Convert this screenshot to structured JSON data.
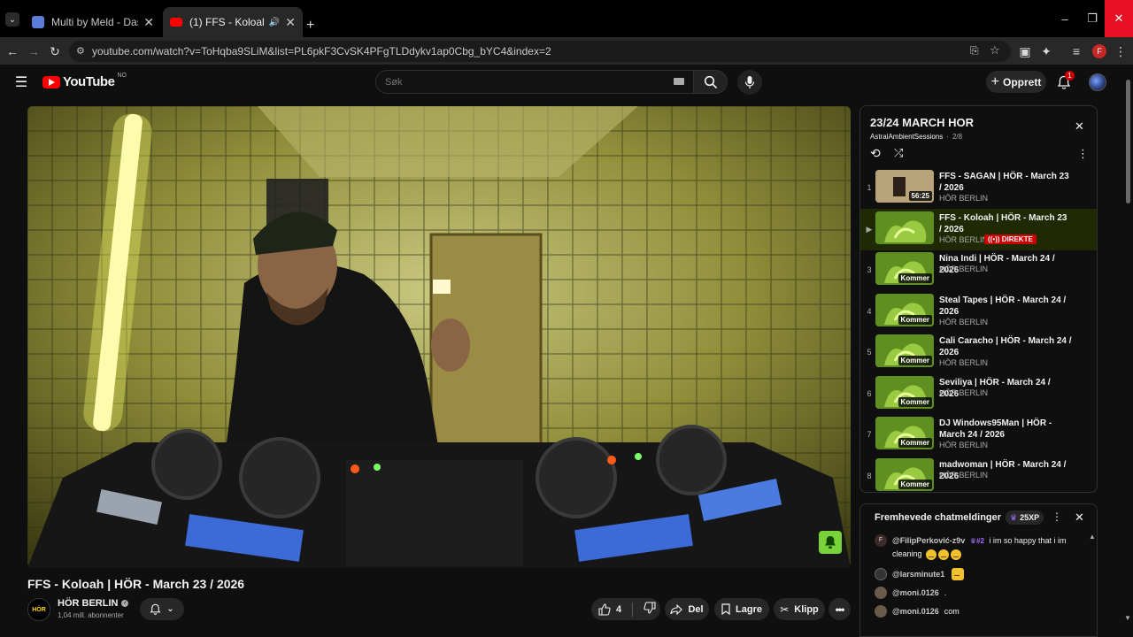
{
  "browser": {
    "tabs": [
      {
        "title": "Multi by Meld - Dashboard",
        "active": false
      },
      {
        "title": "(1) FFS - Koloah | HÖR - Ma",
        "active": true
      }
    ],
    "url": "youtube.com/watch?v=ToHqba9SLiM&list=PL6pkF3CvSK4PFgTLDdykv1ap0Cbg_bYC4&index=2",
    "profile_initial": "F"
  },
  "header": {
    "logo_text": "YouTube",
    "region": "NO",
    "search_placeholder": "Søk",
    "create_label": "Opprett",
    "notification_count": "1"
  },
  "video": {
    "title": "FFS - Koloah | HÖR - March 23 / 2026",
    "channel_logo": "HÖR",
    "channel": "HÖR BERLIN",
    "subscribers": "1,04 mill. abonnenter",
    "likes": "4",
    "share_label": "Del",
    "save_label": "Lagre",
    "clip_label": "Klipp"
  },
  "playlist": {
    "title": "23/24 MARCH HOR",
    "owner": "AstralAmbientSessions",
    "position": "2/8",
    "items": [
      {
        "num": "1",
        "title": "FFS - SAGAN | HÖR - March 23 / 2026",
        "channel": "HÖR BERLIN",
        "badge": "56:25"
      },
      {
        "num": "▶",
        "title": "FFS - Koloah | HÖR - March 23 / 2026",
        "channel": "HÖR BERLIN",
        "badge": "",
        "live": "DIREKTE"
      },
      {
        "num": "3",
        "title": "Nina Indi | HÖR - March 24 / 2026",
        "channel": "HÖR BERLIN",
        "badge": "Kommer"
      },
      {
        "num": "4",
        "title": "Steal Tapes | HÖR - March 24 / 2026",
        "channel": "HÖR BERLIN",
        "badge": "Kommer"
      },
      {
        "num": "5",
        "title": "Cali Caracho | HÖR - March 24 / 2026",
        "channel": "HÖR BERLIN",
        "badge": "Kommer"
      },
      {
        "num": "6",
        "title": "Seviliya | HÖR - March 24 / 2026",
        "channel": "HÖR BERLIN",
        "badge": "Kommer"
      },
      {
        "num": "7",
        "title": "DJ Windows95Man | HÖR - March 24 / 2026",
        "channel": "HÖR BERLIN",
        "badge": "Kommer"
      },
      {
        "num": "8",
        "title": "madwoman | HÖR - March 24 / 2026",
        "channel": "HÖR BERLIN",
        "badge": "Kommer"
      }
    ]
  },
  "chat": {
    "header": "Fremhevede chatmeldinger",
    "xp": "25XP",
    "messages": [
      {
        "author": "@FilipPerković-z9v",
        "rank": "#2",
        "text": "i im so happy that i im cleaning",
        "initial": "F"
      },
      {
        "author": "@larsminute1",
        "text": ""
      },
      {
        "author": "@moni.0126",
        "text": "."
      },
      {
        "author": "@moni.0126",
        "text": "com"
      }
    ]
  },
  "colors": {
    "accent_red": "#ff0000",
    "playlist_active_bg": "#1f2a05",
    "live_red": "#cc0000"
  }
}
